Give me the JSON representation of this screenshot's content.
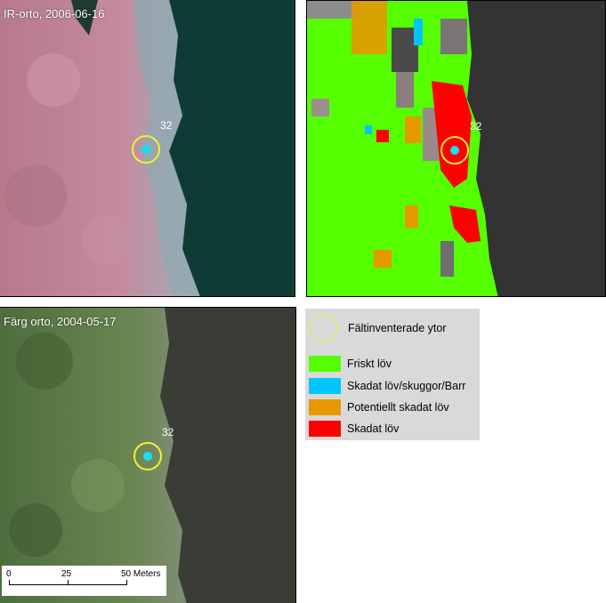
{
  "panels": {
    "ir": {
      "title": "IR-orto, 2006-06-16",
      "plot_label": "32"
    },
    "classified": {
      "plot_label": "32"
    },
    "color": {
      "title": "Färg orto, 2004-05-17",
      "plot_label": "32"
    }
  },
  "legend": {
    "field_plots_label": "Fältinventerade ytor",
    "items": [
      {
        "label": "Friskt löv",
        "color": "#55ff00"
      },
      {
        "label": "Skadat löv/skuggor/Barr",
        "color": "#00c5ff"
      },
      {
        "label": "Potentiellt skadat löv",
        "color": "#e69800"
      },
      {
        "label": "Skadat löv",
        "color": "#ff0000"
      }
    ]
  },
  "scalebar": {
    "labels": [
      "0",
      "25",
      "50 Meters"
    ]
  },
  "colors": {
    "marker_ring": "#f3f02e",
    "marker_dot": "#14e0f0",
    "water_ir": "#0f3b35",
    "water_class": "#333333",
    "water_color": "#3a3d35"
  }
}
